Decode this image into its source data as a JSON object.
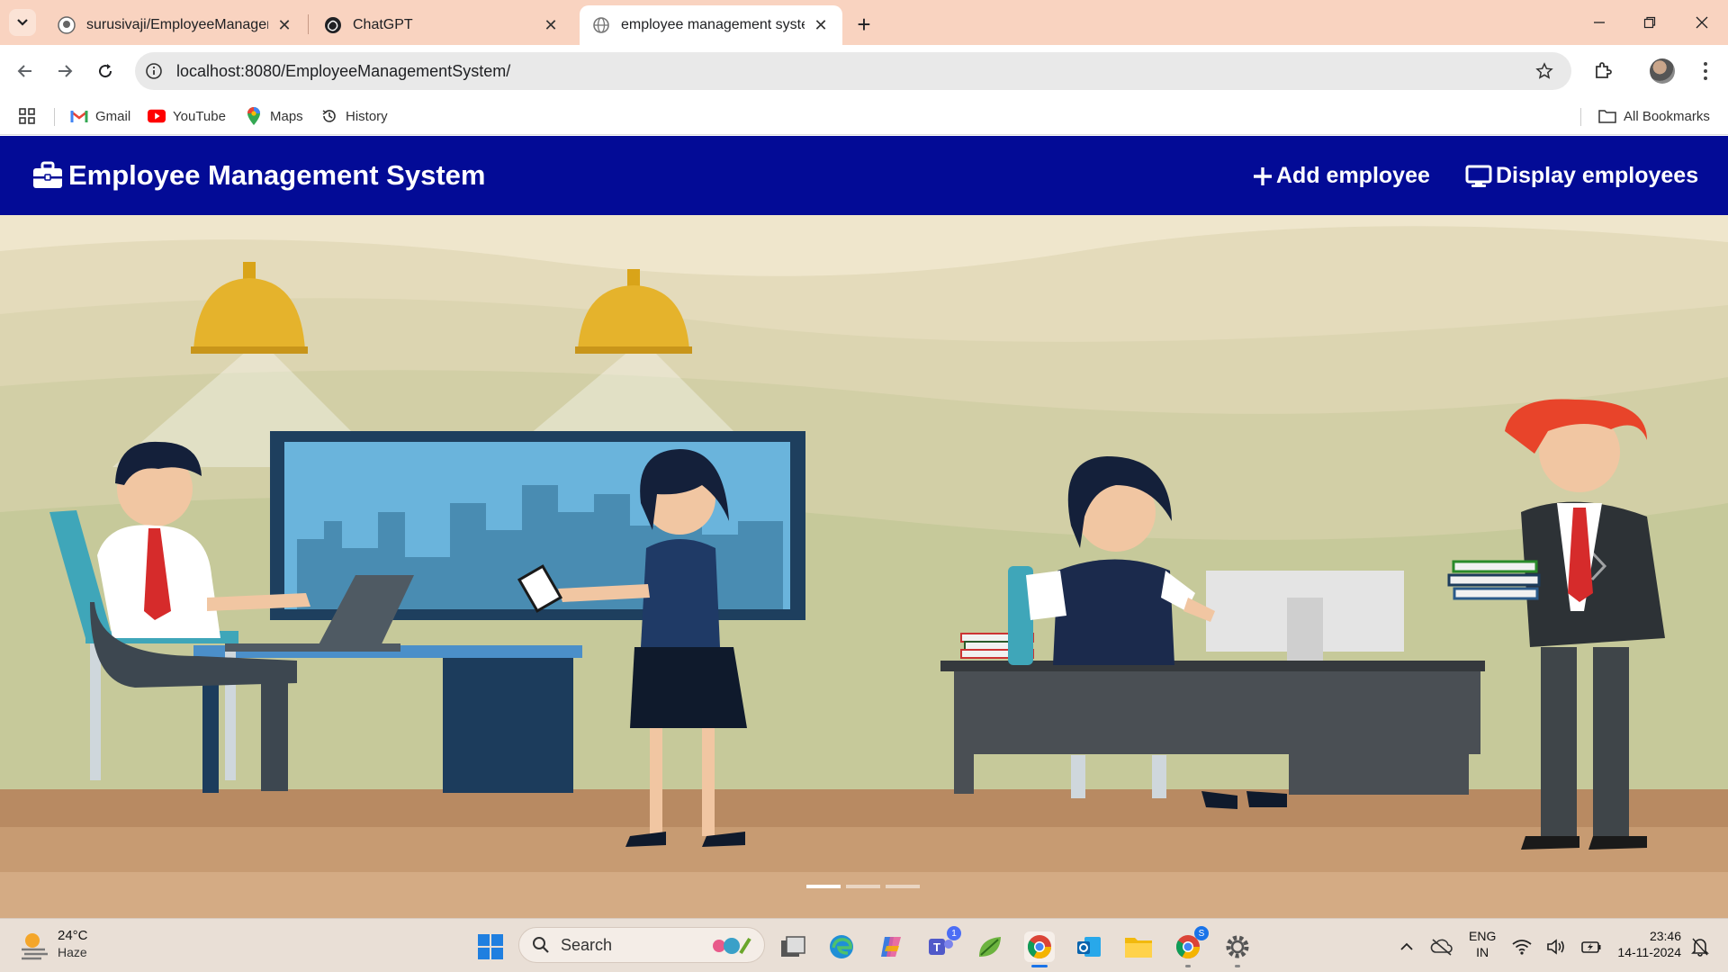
{
  "browser": {
    "tabs": [
      {
        "title": "surusivaji/EmployeeManageme",
        "icon": "github-icon",
        "active": false
      },
      {
        "title": "ChatGPT",
        "icon": "chatgpt-icon",
        "active": false
      },
      {
        "title": "employee management system",
        "icon": "globe-icon",
        "active": true
      }
    ],
    "url": "localhost:8080/EmployeeManagementSystem/",
    "bookmarks": [
      {
        "label": "Gmail",
        "icon": "gmail-icon"
      },
      {
        "label": "YouTube",
        "icon": "youtube-icon"
      },
      {
        "label": "Maps",
        "icon": "maps-icon"
      },
      {
        "label": "History",
        "icon": "history-icon"
      }
    ],
    "all_bookmarks": "All Bookmarks"
  },
  "page": {
    "brand": "Employee Management System",
    "nav": {
      "add": "Add employee",
      "display": "Display employees"
    },
    "carousel": {
      "slide_count": 3,
      "active_index": 0,
      "colors": {
        "navbar": "#030b96",
        "wall": "#e8dfc4",
        "floor": "#b88a62"
      }
    }
  },
  "taskbar": {
    "weather_temp": "24°C",
    "weather_desc": "Haze",
    "search_placeholder": "Search",
    "teams_badge": "1",
    "chrome_badge": "S",
    "lang_top": "ENG",
    "lang_bottom": "IN",
    "time": "23:46",
    "date": "14-11-2024"
  }
}
